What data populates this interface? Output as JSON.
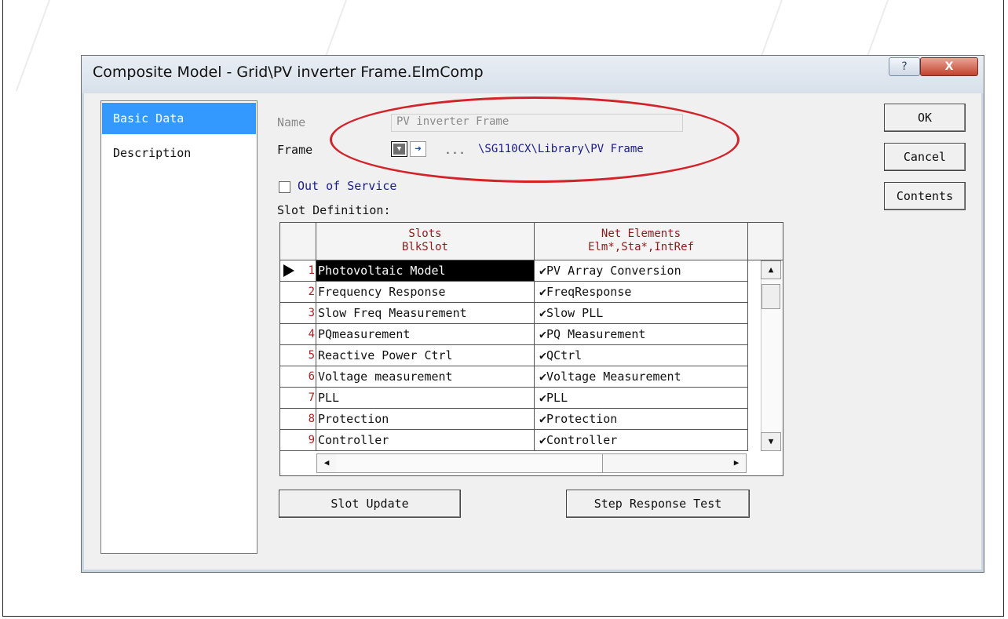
{
  "window": {
    "title": "Composite Model - Grid\\PV inverter Frame.ElmComp",
    "help_label": "?",
    "close_label": "X"
  },
  "nav": {
    "items": [
      {
        "label": "Basic Data",
        "selected": true
      },
      {
        "label": "Description",
        "selected": false
      }
    ]
  },
  "form": {
    "name_label": "Name",
    "name_value": "PV inverter Frame",
    "frame_label": "Frame",
    "frame_dropdown_icon": "dropdown-icon",
    "frame_jump_icon": "arrow-right-icon",
    "frame_ellipsis": "...",
    "frame_path": "\\SG110CX\\Library\\PV Frame",
    "out_of_service_label": "Out of Service",
    "out_of_service_checked": false,
    "slot_definition_label": "Slot Definition:"
  },
  "grid": {
    "col_slots_line1": "Slots",
    "col_slots_line2": "BlkSlot",
    "col_net_line1": "Net Elements",
    "col_net_line2": "Elm*,Sta*,IntRef",
    "rows": [
      {
        "index": "1",
        "slot": "Photovoltaic Model",
        "net": "✔PV Array Conversion"
      },
      {
        "index": "2",
        "slot": "Frequency Response",
        "net": "✔FreqResponse"
      },
      {
        "index": "3",
        "slot": "Slow Freq Measurement",
        "net": "✔Slow PLL"
      },
      {
        "index": "4",
        "slot": "PQmeasurement",
        "net": "✔PQ Measurement"
      },
      {
        "index": "5",
        "slot": "Reactive Power Ctrl",
        "net": "✔QCtrl"
      },
      {
        "index": "6",
        "slot": "Voltage measurement",
        "net": "✔Voltage Measurement"
      },
      {
        "index": "7",
        "slot": "PLL",
        "net": "✔PLL"
      },
      {
        "index": "8",
        "slot": "Protection",
        "net": "✔Protection"
      },
      {
        "index": "9",
        "slot": "Controller",
        "net": "✔Controller"
      }
    ],
    "selected_row": 1
  },
  "buttons": {
    "ok": "OK",
    "cancel": "Cancel",
    "contents": "Contents",
    "slot_update": "Slot Update",
    "step_response_test": "Step Response Test"
  },
  "colors": {
    "annotation_ellipse": "#d3232a",
    "selection": "#3399ff",
    "path_text": "#1a1a8a",
    "header_text": "#8b1a1a",
    "index_text": "#b21e1e"
  }
}
